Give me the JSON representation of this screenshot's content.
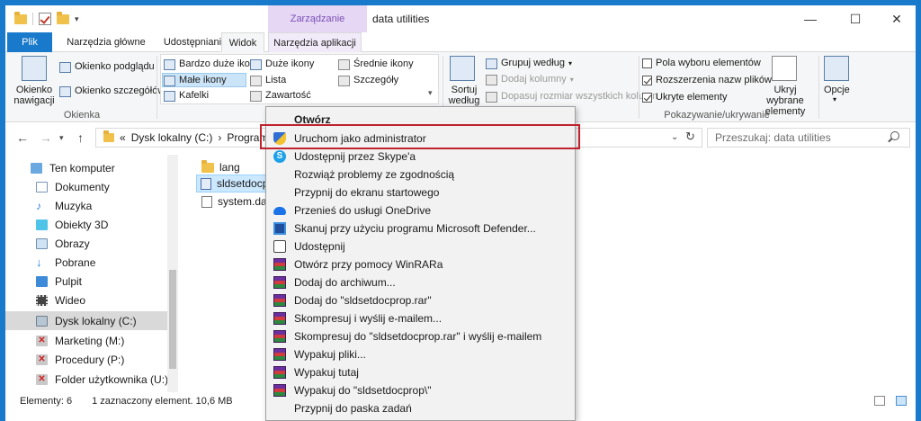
{
  "window": {
    "title": "data utilities",
    "context_tab": "Zarządzanie",
    "controls": {
      "minimize": "—",
      "maximize": "☐",
      "close": "✕"
    }
  },
  "tabs": [
    "Plik",
    "Narzędzia główne",
    "Udostępnianie",
    "Widok",
    "Narzędzia aplikacji"
  ],
  "ribbon": {
    "panes": {
      "nav_pane_label": "Okienko nawigacji",
      "preview_pane": "Okienko podglądu",
      "details_pane": "Okienko szczegółów",
      "group_label": "Okienka"
    },
    "layout": {
      "extra_large": "Bardzo duże ikony",
      "large": "Duże ikony",
      "medium": "Średnie ikony",
      "small": "Małe ikony",
      "list": "Lista",
      "details": "Szczegóły",
      "tiles": "Kafelki",
      "content": "Zawartość"
    },
    "current_view": {
      "sort_by": "Sortuj według",
      "group_by": "Grupuj według",
      "add_columns": "Dodaj kolumny",
      "fit_columns": "Dopasuj rozmiar wszystkich kolumn"
    },
    "show_hide": {
      "item_checkboxes": "Pola wyboru elementów",
      "file_extensions": "Rozszerzenia nazw plików",
      "hidden_items": "Ukryte elementy",
      "item_checkboxes_checked": false,
      "file_extensions_checked": true,
      "hidden_items_checked": true,
      "hide_selected": "Ukryj wybrane elementy",
      "group_label": "Pokazywanie/ukrywanie"
    },
    "options": "Opcje"
  },
  "address": {
    "crumb_root": "«",
    "crumbs": [
      "Dysk lokalny (C:)",
      "Program Files"
    ],
    "search_placeholder": "Przeszukaj: data utilities"
  },
  "nav_pane": [
    {
      "label": "Ten komputer",
      "icon": "computer-icon"
    },
    {
      "label": "Dokumenty",
      "icon": "documents-icon"
    },
    {
      "label": "Muzyka",
      "icon": "music-icon"
    },
    {
      "label": "Obiekty 3D",
      "icon": "objects-3d-icon"
    },
    {
      "label": "Obrazy",
      "icon": "pictures-icon"
    },
    {
      "label": "Pobrane",
      "icon": "downloads-icon"
    },
    {
      "label": "Pulpit",
      "icon": "desktop-icon"
    },
    {
      "label": "Wideo",
      "icon": "video-icon"
    },
    {
      "label": "Dysk lokalny (C:)",
      "icon": "drive-icon"
    },
    {
      "label": "Marketing (M:)",
      "icon": "network-drive-disconnected-icon"
    },
    {
      "label": "Procedury (P:)",
      "icon": "network-drive-disconnected-icon"
    },
    {
      "label": "Folder użytkownika (U:)",
      "icon": "network-drive-disconnected-icon"
    }
  ],
  "files": [
    {
      "name": "lang",
      "icon": "folder-icon"
    },
    {
      "name": "sldsetdocprop",
      "icon": "application-icon"
    },
    {
      "name": "system.data.s",
      "icon": "file-icon"
    }
  ],
  "status": {
    "count": "Elementy: 6",
    "selection": "1 zaznaczony element. 10,6 MB"
  },
  "context_menu": [
    {
      "label": "Otwórz",
      "icon": "",
      "bold": true
    },
    {
      "label": "Uruchom jako administrator",
      "icon": "uac-shield-icon"
    },
    {
      "label": "Udostępnij przez Skype'a",
      "icon": "skype-icon"
    },
    {
      "label": "Rozwiąż problemy ze zgodnością",
      "icon": ""
    },
    {
      "label": "Przypnij do ekranu startowego",
      "icon": ""
    },
    {
      "label": "Przenieś do usługi OneDrive",
      "icon": "onedrive-icon"
    },
    {
      "label": "Skanuj przy użyciu programu Microsoft Defender...",
      "icon": "defender-icon"
    },
    {
      "label": "Udostępnij",
      "icon": "share-icon"
    },
    {
      "label": "Otwórz przy pomocy WinRARa",
      "icon": "winrar-icon"
    },
    {
      "label": "Dodaj do archiwum...",
      "icon": "winrar-icon"
    },
    {
      "label": "Dodaj do \"sldsetdocprop.rar\"",
      "icon": "winrar-icon"
    },
    {
      "label": "Skompresuj i wyślij e-mailem...",
      "icon": "winrar-icon"
    },
    {
      "label": "Skompresuj do \"sldsetdocprop.rar\" i wyślij e-mailem",
      "icon": "winrar-icon"
    },
    {
      "label": "Wypakuj pliki...",
      "icon": "winrar-icon"
    },
    {
      "label": "Wypakuj tutaj",
      "icon": "winrar-icon"
    },
    {
      "label": "Wypakuj do \"sldsetdocprop\\\"",
      "icon": "winrar-icon"
    },
    {
      "label": "Przypnij do paska zadań",
      "icon": ""
    }
  ],
  "colors": {
    "frame": "#1979ca",
    "manage_tab": "#e6d7f5",
    "selection": "#cce8ff",
    "highlight_box": "#c0222e"
  }
}
